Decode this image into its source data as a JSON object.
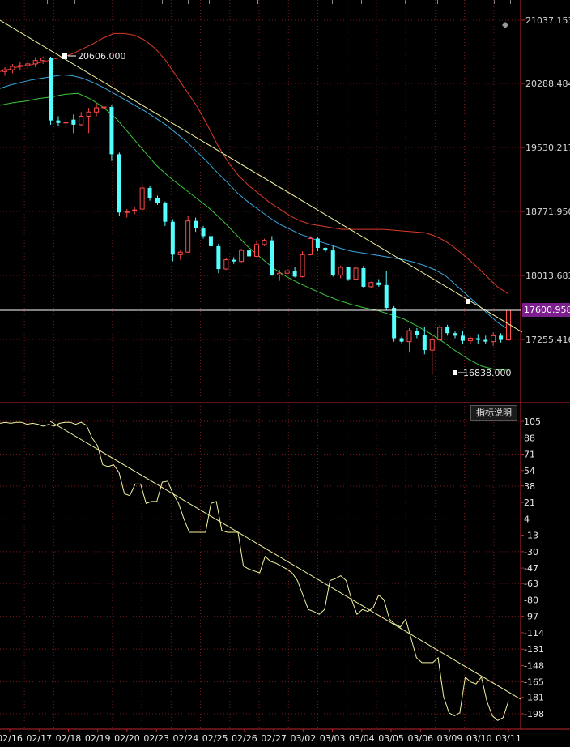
{
  "chart_data": [
    {
      "type": "candlestick",
      "price_axis_ticks": [
        "21037.153",
        "20288.484",
        "19530.217",
        "18771.950",
        "18013.683",
        "17255.416"
      ],
      "current_price_label": "17600.958",
      "annotations": {
        "high_label": "20606.000",
        "low_label": "16838.000"
      },
      "indicator_button": "指标说明",
      "dates": [
        "02/16",
        "02/17",
        "02/18",
        "02/19",
        "02/20",
        "02/23",
        "02/24",
        "02/25",
        "02/26",
        "02/27",
        "03/02",
        "03/03",
        "03/04",
        "03/05",
        "03/06",
        "03/09",
        "03/10",
        "03/11"
      ],
      "candles": [
        [
          20430,
          20480,
          20380,
          20450
        ],
        [
          20450,
          20520,
          20410,
          20490
        ],
        [
          20490,
          20540,
          20440,
          20500
        ],
        [
          20500,
          20560,
          20460,
          20520
        ],
        [
          20520,
          20600,
          20480,
          20560
        ],
        [
          20560,
          20606,
          20520,
          20590
        ],
        [
          20590,
          20606,
          19800,
          19850
        ],
        [
          19850,
          19900,
          19780,
          19820
        ],
        [
          19820,
          19890,
          19760,
          19830
        ],
        [
          19860,
          19920,
          19700,
          19800
        ],
        [
          19800,
          19950,
          19790,
          19900
        ],
        [
          19900,
          20000,
          19700,
          19950
        ],
        [
          19950,
          20050,
          19900,
          20000
        ],
        [
          20000,
          20060,
          19950,
          20010
        ],
        [
          20010,
          20030,
          19370,
          19450
        ],
        [
          19450,
          19470,
          18720,
          18760
        ],
        [
          18760,
          18800,
          18700,
          18770
        ],
        [
          18790,
          18830,
          18740,
          18790
        ],
        [
          18800,
          19110,
          18790,
          19050
        ],
        [
          19050,
          19080,
          18900,
          18930
        ],
        [
          18930,
          18960,
          18850,
          18870
        ],
        [
          18870,
          18890,
          18600,
          18650
        ],
        [
          18650,
          18680,
          18180,
          18260
        ],
        [
          18260,
          18310,
          18200,
          18290
        ],
        [
          18290,
          18720,
          18280,
          18660
        ],
        [
          18660,
          18700,
          18530,
          18570
        ],
        [
          18570,
          18600,
          18450,
          18480
        ],
        [
          18480,
          18520,
          18320,
          18360
        ],
        [
          18360,
          18390,
          18040,
          18090
        ],
        [
          18090,
          18220,
          18080,
          18200
        ],
        [
          18200,
          18230,
          18150,
          18180
        ],
        [
          18180,
          18330,
          18170,
          18310
        ],
        [
          18310,
          18330,
          18210,
          18240
        ],
        [
          18240,
          18430,
          18230,
          18380
        ],
        [
          18380,
          18450,
          18360,
          18430
        ],
        [
          18430,
          18480,
          18010,
          18020
        ],
        [
          18020,
          18080,
          17950,
          18040
        ],
        [
          18040,
          18090,
          18010,
          18070
        ],
        [
          18070,
          18110,
          17990,
          18000
        ],
        [
          18000,
          18300,
          17990,
          18260
        ],
        [
          18260,
          18480,
          18250,
          18450
        ],
        [
          18450,
          18470,
          18300,
          18340
        ],
        [
          18340,
          18350,
          18290,
          18310
        ],
        [
          18310,
          18360,
          18000,
          18020
        ],
        [
          18020,
          18130,
          17980,
          18110
        ],
        [
          18110,
          18120,
          17950,
          17970
        ],
        [
          17970,
          18110,
          17960,
          18100
        ],
        [
          18100,
          18130,
          17870,
          17880
        ],
        [
          17880,
          17940,
          17870,
          17930
        ],
        [
          17930,
          17970,
          17880,
          17900
        ],
        [
          17900,
          18070,
          17600,
          17630
        ],
        [
          17630,
          17650,
          17230,
          17270
        ],
        [
          17270,
          17290,
          17210,
          17230
        ],
        [
          17230,
          17390,
          17100,
          17360
        ],
        [
          17360,
          17390,
          17270,
          17310
        ],
        [
          17310,
          17400,
          17080,
          17130
        ],
        [
          17130,
          17300,
          16838,
          17250
        ],
        [
          17250,
          17430,
          17230,
          17400
        ],
        [
          17400,
          17430,
          17300,
          17330
        ],
        [
          17330,
          17350,
          17270,
          17300
        ],
        [
          17300,
          17360,
          17200,
          17240
        ],
        [
          17240,
          17290,
          17200,
          17270
        ],
        [
          17270,
          17320,
          17200,
          17250
        ],
        [
          17250,
          17300,
          17200,
          17230
        ],
        [
          17230,
          17340,
          17180,
          17300
        ],
        [
          17300,
          17330,
          17220,
          17250
        ],
        [
          17250,
          17600,
          17240,
          17600
        ]
      ],
      "bollinger": {
        "upper": [
          20430,
          20460,
          20490,
          20510,
          20540,
          20570,
          20600,
          20640,
          20700,
          20760,
          20830,
          20880,
          20880,
          20860,
          20800,
          20700,
          20560,
          20380,
          20200,
          20020,
          19800,
          19560,
          19360,
          19200,
          19080,
          18980,
          18880,
          18800,
          18720,
          18660,
          18620,
          18600,
          18580,
          18560,
          18560,
          18560,
          18560,
          18560,
          18550,
          18540,
          18530,
          18520,
          18480,
          18420,
          18330,
          18230,
          18120,
          18000,
          17880,
          17800
        ],
        "mid": [
          20230,
          20270,
          20300,
          20330,
          20350,
          20370,
          20390,
          20380,
          20350,
          20300,
          20240,
          20170,
          20100,
          20030,
          19960,
          19880,
          19800,
          19700,
          19600,
          19480,
          19360,
          19230,
          19110,
          18980,
          18880,
          18790,
          18700,
          18620,
          18560,
          18500,
          18460,
          18410,
          18370,
          18330,
          18300,
          18280,
          18260,
          18240,
          18220,
          18200,
          18170,
          18130,
          18080,
          18010,
          17900,
          17790,
          17680,
          17570,
          17460,
          17380
        ],
        "lower": [
          20030,
          20060,
          20080,
          20110,
          20130,
          20160,
          20170,
          20100,
          20000,
          19860,
          19680,
          19500,
          19320,
          19180,
          19060,
          18940,
          18820,
          18680,
          18520,
          18360,
          18230,
          18100,
          18000,
          17920,
          17850,
          17780,
          17720,
          17670,
          17630,
          17600,
          17550,
          17500,
          17420,
          17330,
          17230,
          17120,
          17020,
          16940,
          16900,
          16890
        ]
      }
    },
    {
      "type": "line",
      "y_ticks": [
        "105",
        "88",
        "71",
        "54",
        "38",
        "21",
        "4",
        "-13",
        "-30",
        "-47",
        "-63",
        "-80",
        "-97",
        "-114",
        "-131",
        "-148",
        "-165",
        "-181",
        "-198"
      ],
      "series": [
        {
          "values": [
            103,
            104,
            103,
            104,
            104,
            102,
            103,
            102,
            100,
            102,
            100,
            103,
            104,
            104,
            102,
            104,
            101,
            88,
            80,
            60,
            58,
            60,
            52,
            30,
            28,
            40,
            40,
            20,
            22,
            22,
            42,
            43,
            30,
            20,
            4,
            -10,
            -10,
            -10,
            -10,
            20,
            22,
            -8,
            -10,
            -10,
            -10,
            -45,
            -48,
            -50,
            -52,
            -35,
            -40,
            -42,
            -45,
            -48,
            -52,
            -60,
            -75,
            -90,
            -92,
            -95,
            -90,
            -60,
            -58,
            -55,
            -60,
            -80,
            -95,
            -90,
            -92,
            -88,
            -75,
            -80,
            -100,
            -105,
            -108,
            -100,
            -120,
            -140,
            -145,
            -145,
            -145,
            -140,
            -180,
            -197,
            -200,
            -197,
            -160,
            -165,
            -167,
            -160,
            -185,
            -200,
            -205,
            -202,
            -185
          ]
        }
      ]
    }
  ]
}
